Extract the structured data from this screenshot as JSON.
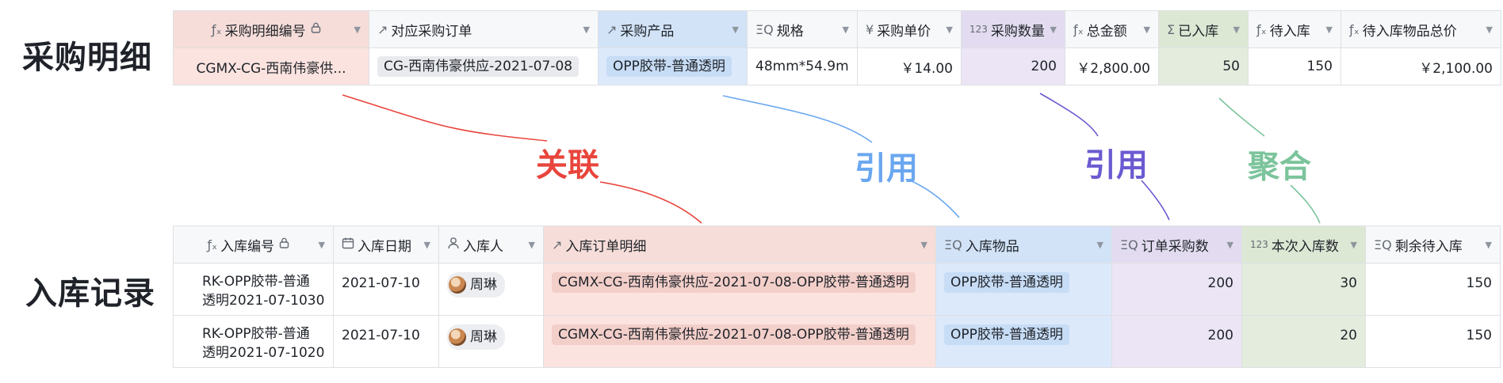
{
  "labels": {
    "top_section": "采购明细",
    "bottom_section": "入库记录",
    "annot_link": "关联",
    "annot_ref1": "引用",
    "annot_ref2": "引用",
    "annot_agg": "聚合"
  },
  "colors": {
    "link": "#e8453c",
    "ref1": "#6aa7f0",
    "ref2": "#6a5bd1",
    "agg": "#7cc49c"
  },
  "purchase": {
    "headers": [
      {
        "icon": "formula-icon",
        "label": "采购明细编号"
      },
      {
        "icon": "link-arrow-icon",
        "label": "对应采购订单"
      },
      {
        "icon": "link-arrow-icon",
        "label": "采购产品"
      },
      {
        "icon": "lookup-icon",
        "label": "规格"
      },
      {
        "icon": "currency-icon",
        "label": "采购单价"
      },
      {
        "icon": "number-icon",
        "label": "采购数量"
      },
      {
        "icon": "formula-icon",
        "label": "总金额"
      },
      {
        "icon": "sum-icon",
        "label": "已入库"
      },
      {
        "icon": "formula-icon",
        "label": "待入库"
      },
      {
        "icon": "formula-icon",
        "label": "待入库物品总价"
      }
    ],
    "row": {
      "code": "CGMX-CG-西南伟豪供...",
      "order": "CG-西南伟豪供应-2021-07-08",
      "product": "OPP胶带-普通透明",
      "spec": "48mm*54.9m",
      "unit_price": "￥14.00",
      "quantity": "200",
      "total": "￥2,800.00",
      "stocked": "50",
      "pending": "150",
      "pending_total": "￥2,100.00"
    }
  },
  "inbound": {
    "headers": [
      {
        "icon": "formula-icon",
        "label": "入库编号"
      },
      {
        "icon": "calendar-icon",
        "label": "入库日期"
      },
      {
        "icon": "person-icon",
        "label": "入库人"
      },
      {
        "icon": "link-arrow-icon",
        "label": "入库订单明细"
      },
      {
        "icon": "lookup-icon",
        "label": "入库物品"
      },
      {
        "icon": "lookup-icon",
        "label": "订单采购数"
      },
      {
        "icon": "number-icon",
        "label": "本次入库数"
      },
      {
        "icon": "lookup-icon",
        "label": "剩余待入库"
      }
    ],
    "rows": [
      {
        "code_line1": "RK-OPP胶带-普通",
        "code_line2": "透明2021-07-1030",
        "date": "2021-07-10",
        "person": "周琳",
        "detail": "CGMX-CG-西南伟豪供应-2021-07-08-OPP胶带-普通透明",
        "item": "OPP胶带-普通透明",
        "order_qty": "200",
        "this_qty": "30",
        "remaining": "150"
      },
      {
        "code_line1": "RK-OPP胶带-普通",
        "code_line2": "透明2021-07-1020",
        "date": "2021-07-10",
        "person": "周琳",
        "detail": "CGMX-CG-西南伟豪供应-2021-07-08-OPP胶带-普通透明",
        "item": "OPP胶带-普通透明",
        "order_qty": "200",
        "this_qty": "20",
        "remaining": "150"
      }
    ]
  }
}
